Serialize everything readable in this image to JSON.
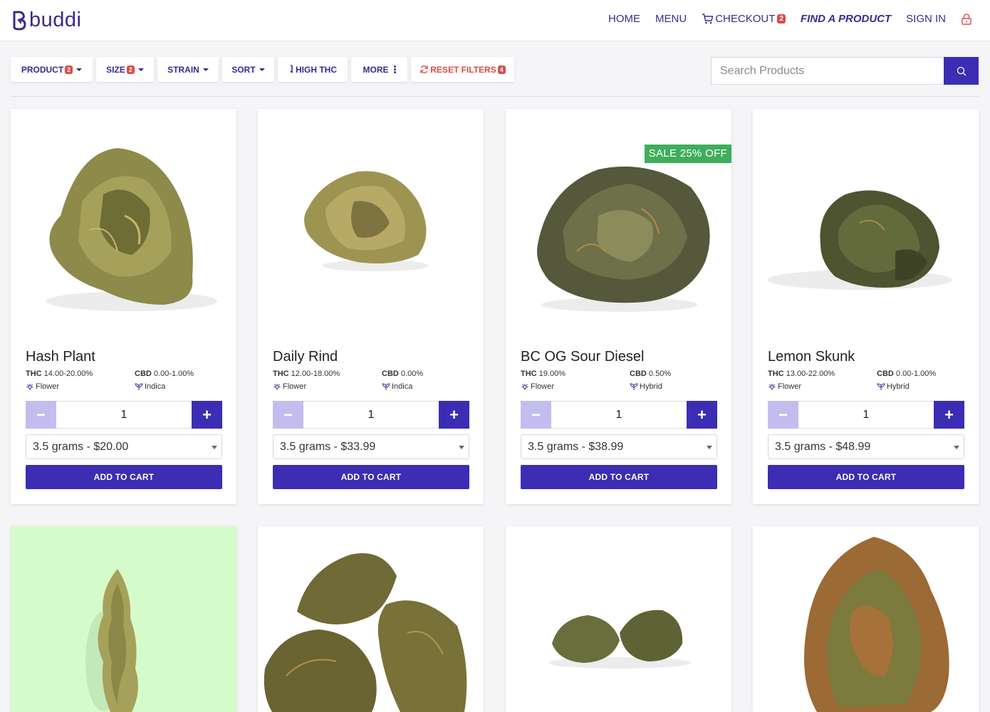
{
  "brand": {
    "name": "buddi"
  },
  "nav": {
    "home": "HOME",
    "menu": "MENU",
    "checkout": "CHECKOUT",
    "checkout_count": "2",
    "find": "FIND A PRODUCT",
    "signin": "SIGN IN"
  },
  "filters": {
    "product": "PRODUCT",
    "product_count": "2",
    "size": "SIZE",
    "size_count": "2",
    "strain": "STRAIN",
    "sort": "SORT",
    "high_thc": "HIGH THC",
    "more": "MORE",
    "reset": "RESET FILTERS",
    "reset_count": "4"
  },
  "search": {
    "placeholder": "Search Products"
  },
  "products": [
    {
      "name": "Hash Plant",
      "thc_label": "THC",
      "thc": "14.00-20.00%",
      "cbd_label": "CBD",
      "cbd": "0.00-1.00%",
      "category": "Flower",
      "strain": "Indica",
      "qty": "1",
      "size": "3.5 grams - $20.00",
      "add": "ADD TO CART"
    },
    {
      "name": "Daily Rind",
      "thc_label": "THC",
      "thc": "12.00-18.00%",
      "cbd_label": "CBD",
      "cbd": "0.00%",
      "category": "Flower",
      "strain": "Indica",
      "qty": "1",
      "size": "3.5 grams - $33.99",
      "add": "ADD TO CART"
    },
    {
      "name": "BC OG Sour Diesel",
      "thc_label": "THC",
      "thc": "19.00%",
      "cbd_label": "CBD",
      "cbd": "0.50%",
      "category": "Flower",
      "strain": "Hybrid",
      "qty": "1",
      "size": "3.5 grams - $38.99",
      "add": "ADD TO CART",
      "sale": "SALE 25% OFF"
    },
    {
      "name": "Lemon Skunk",
      "thc_label": "THC",
      "thc": "13.00-22.00%",
      "cbd_label": "CBD",
      "cbd": "0.00-1.00%",
      "category": "Flower",
      "strain": "Hybrid",
      "qty": "1",
      "size": "3.5 grams - $48.99",
      "add": "ADD TO CART"
    }
  ],
  "colors": {
    "primary": "#3b2db4",
    "brand": "#3a2a8e",
    "badge": "#e04a48",
    "sale": "#3fae5a",
    "minus": "#c3bdef"
  }
}
